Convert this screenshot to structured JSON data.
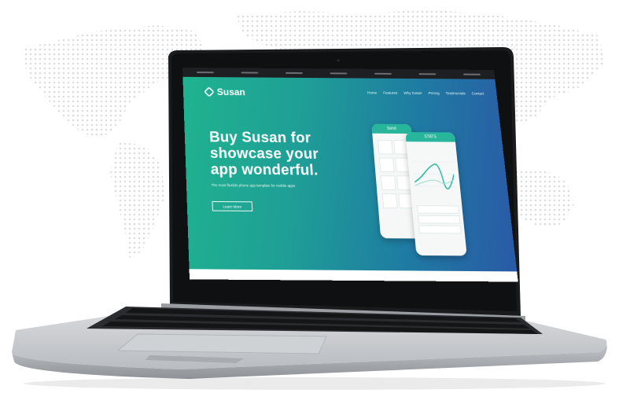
{
  "site": {
    "logo_text": "Susan",
    "nav": [
      "Home",
      "Features",
      "Why Susan",
      "Pricing",
      "Testimonials",
      "Contact"
    ],
    "headline": [
      "Buy Susan for",
      "showcase your",
      "app wonderful."
    ],
    "subheadline": "The most flexible phone app template for mobile apps",
    "cta_label": "Learn More",
    "phone_left_title": "Send",
    "phone_right_title": "STATS"
  },
  "colors": {
    "hero_start": "#1fb38f",
    "hero_end": "#2a5aa6",
    "phone_accent": "#27b59c"
  }
}
